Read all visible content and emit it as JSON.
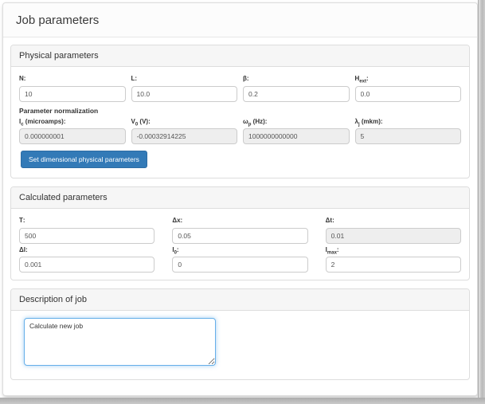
{
  "page": {
    "title": "Job parameters"
  },
  "physical": {
    "heading": "Physical parameters",
    "row1": [
      {
        "base": "N",
        "sub": "",
        "suffix": ":",
        "value": "10"
      },
      {
        "base": "L",
        "sub": "",
        "suffix": ":",
        "value": "10.0"
      },
      {
        "base": "β",
        "sub": "",
        "suffix": ":",
        "value": "0.2"
      },
      {
        "base": "H",
        "sub": "ext",
        "suffix": ":",
        "value": "0.0"
      }
    ],
    "normalization_label": "Parameter normalization",
    "row2": [
      {
        "base": "I",
        "sub": "c",
        "suffix": " (microamps):",
        "value": "0.000000001"
      },
      {
        "base": "V",
        "sub": "0",
        "suffix": " (V):",
        "value": "-0.00032914225"
      },
      {
        "base": "ω",
        "sub": "p",
        "suffix": " (Hz):",
        "value": "1000000000000"
      },
      {
        "base": "λ",
        "sub": "j",
        "suffix": " (mkm):",
        "value": "5"
      }
    ],
    "button_label": "Set dimensional physical parameters"
  },
  "calculated": {
    "heading": "Calculated parameters",
    "row1": [
      {
        "base": "T",
        "sub": "",
        "suffix": ":",
        "value": "500"
      },
      {
        "base": "Δx",
        "sub": "",
        "suffix": ":",
        "value": "0.05"
      },
      {
        "base": "Δt",
        "sub": "",
        "suffix": ":",
        "value": "0.01"
      }
    ],
    "row2": [
      {
        "base": "ΔI",
        "sub": "",
        "suffix": ":",
        "value": "0.001"
      },
      {
        "base": "I",
        "sub": "0",
        "suffix": ":",
        "value": "0"
      },
      {
        "base": "I",
        "sub": "max",
        "suffix": ":",
        "value": "2"
      }
    ]
  },
  "description": {
    "heading": "Description of job",
    "text": "Calculate new job"
  }
}
